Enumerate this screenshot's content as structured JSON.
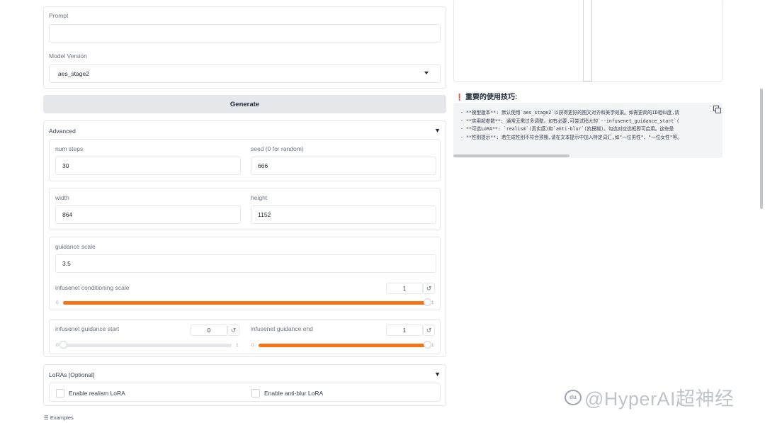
{
  "prompt": {
    "label": "Prompt",
    "value": ""
  },
  "model_version": {
    "label": "Model Version",
    "value": "aes_stage2"
  },
  "generate": {
    "label": "Generate"
  },
  "advanced": {
    "title": "Advanced",
    "toggle": "▼",
    "num_steps": {
      "label": "num steps",
      "value": "30"
    },
    "seed": {
      "label": "seed (0 for random)",
      "value": "666"
    },
    "width": {
      "label": "width",
      "value": "864"
    },
    "height": {
      "label": "height",
      "value": "1152"
    },
    "guidance_scale": {
      "label": "guidance scale",
      "value": "3.5"
    },
    "cond_scale": {
      "label": "infusenet conditioning scale",
      "value": "1",
      "min": "0",
      "max": "1",
      "level": 1.0
    },
    "guidance_start": {
      "label": "infusenet guidance start",
      "value": "0",
      "min": "0",
      "max": "1",
      "level": 0.0
    },
    "guidance_end": {
      "label": "infusenet guidance end",
      "value": "1",
      "min": "0",
      "max": "1",
      "level": 1.0
    },
    "reset_icon": "↺"
  },
  "loras": {
    "title": "LoRAs [Optional]",
    "toggle": "▼",
    "realism": "Enable realism LoRA",
    "anti_blur": "Enable anti-blur LoRA"
  },
  "examples": {
    "icon": "☰",
    "label": "Examples"
  },
  "tips": {
    "icon": "❗",
    "title": "重要的使用技巧:",
    "lines": [
      "- **模型版本**: 默认使用`aes_stage2`以获得更好的图文对齐和美学效果。如需更高的ID相似度,请",
      "- **实用超参数**: 通常无需过多调整。如有必要,可尝试稍大的`--infusenet_guidance_start`(",
      "- **可选LoRA**: `realism`(真实感)和`anti-blur`(抗模糊)。勾选对应选框即可启用。这些是",
      "- **性别提示**: 若生成性别不符合预期,请在文本提示中加入特定词汇,如\"一位男性\"、\"一位女性\"等。"
    ]
  },
  "watermark": {
    "text": "@HyperAI超神经"
  },
  "colors": {
    "accent": "#f97316",
    "border": "#e5e7eb",
    "button_bg": "#e5e7eb"
  }
}
